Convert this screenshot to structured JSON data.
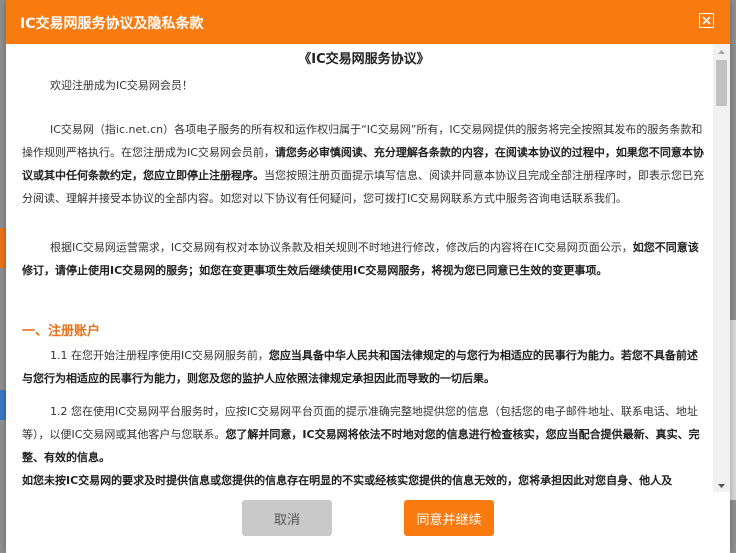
{
  "dialog": {
    "title": "IC交易网服务协议及隐私条款",
    "close_icon": "close-icon"
  },
  "document": {
    "title": "《IC交易网服务协议》",
    "greeting": "欢迎注册成为IC交易网会员！",
    "para1_a": "IC交易网（指ic.net.cn）各项电子服务的所有权和运作权归属于“IC交易网”所有，IC交易网提供的服务将完全按照其发布的服务条款和操作规则严格执行。在您注册成为IC交易网会员前，",
    "para1_b": "请您务必审慎阅读、充分理解各条款的内容，在阅读本协议的过程中，如果您不同意本协议或其中任何条款约定，您应立即停止注册程序。",
    "para1_c": "当您按照注册页面提示填写信息、阅读并同意本协议且完成全部注册程序时，即表示您已充分阅读、理解并接受本协议的全部内容。如您对以下协议有任何疑问，您可拨打IC交易网联系方式中服务咨询电话联系我们。",
    "para2_a": "根据IC交易网运营需求，IC交易网有权对本协议条款及相关规则不时地进行修改，修改后的内容将在IC交易网页面公示，",
    "para2_b": "如您不同意该修订，请停止使用IC交易网的服务；如您在变更事项生效后继续使用IC交易网服务，将视为您已同意已生效的变更事项。",
    "section1_title": "一、注册账户",
    "s1_1_a": "1.1 在您开始注册程序使用IC交易网服务前，",
    "s1_1_b": "您应当具备中华人民共和国法律规定的与您行为相适应的民事行为能力。若您不具备前述与您行为相适应的民事行为能力，则您及您的监护人应依照法律规定承担因此而导致的一切后果。",
    "s1_2_a": "1.2 您在使用IC交易网平台服务时，应按IC交易网平台页面的提示准确完整地提供您的信息（包括您的电子邮件地址、联系电话、地址等），以便IC交易网或其他客户与您联系。",
    "s1_2_b": "您了解并同意，IC交易网将依法不时地对您的信息进行检查核实，您应当配合提供最新、真实、完整、有效的信息。",
    "s1_2_c": "如您未按IC交易网的要求及时提供信息或您提供的信息存在明显的不实或经核实您提供的信息无效的，您将承担因此对您自身、他人及"
  },
  "footer": {
    "cancel_label": "取消",
    "agree_label": "同意并继续"
  },
  "colors": {
    "accent": "#f97a0f",
    "section_title": "#e8731b",
    "cancel_bg": "#c9c9c9"
  }
}
